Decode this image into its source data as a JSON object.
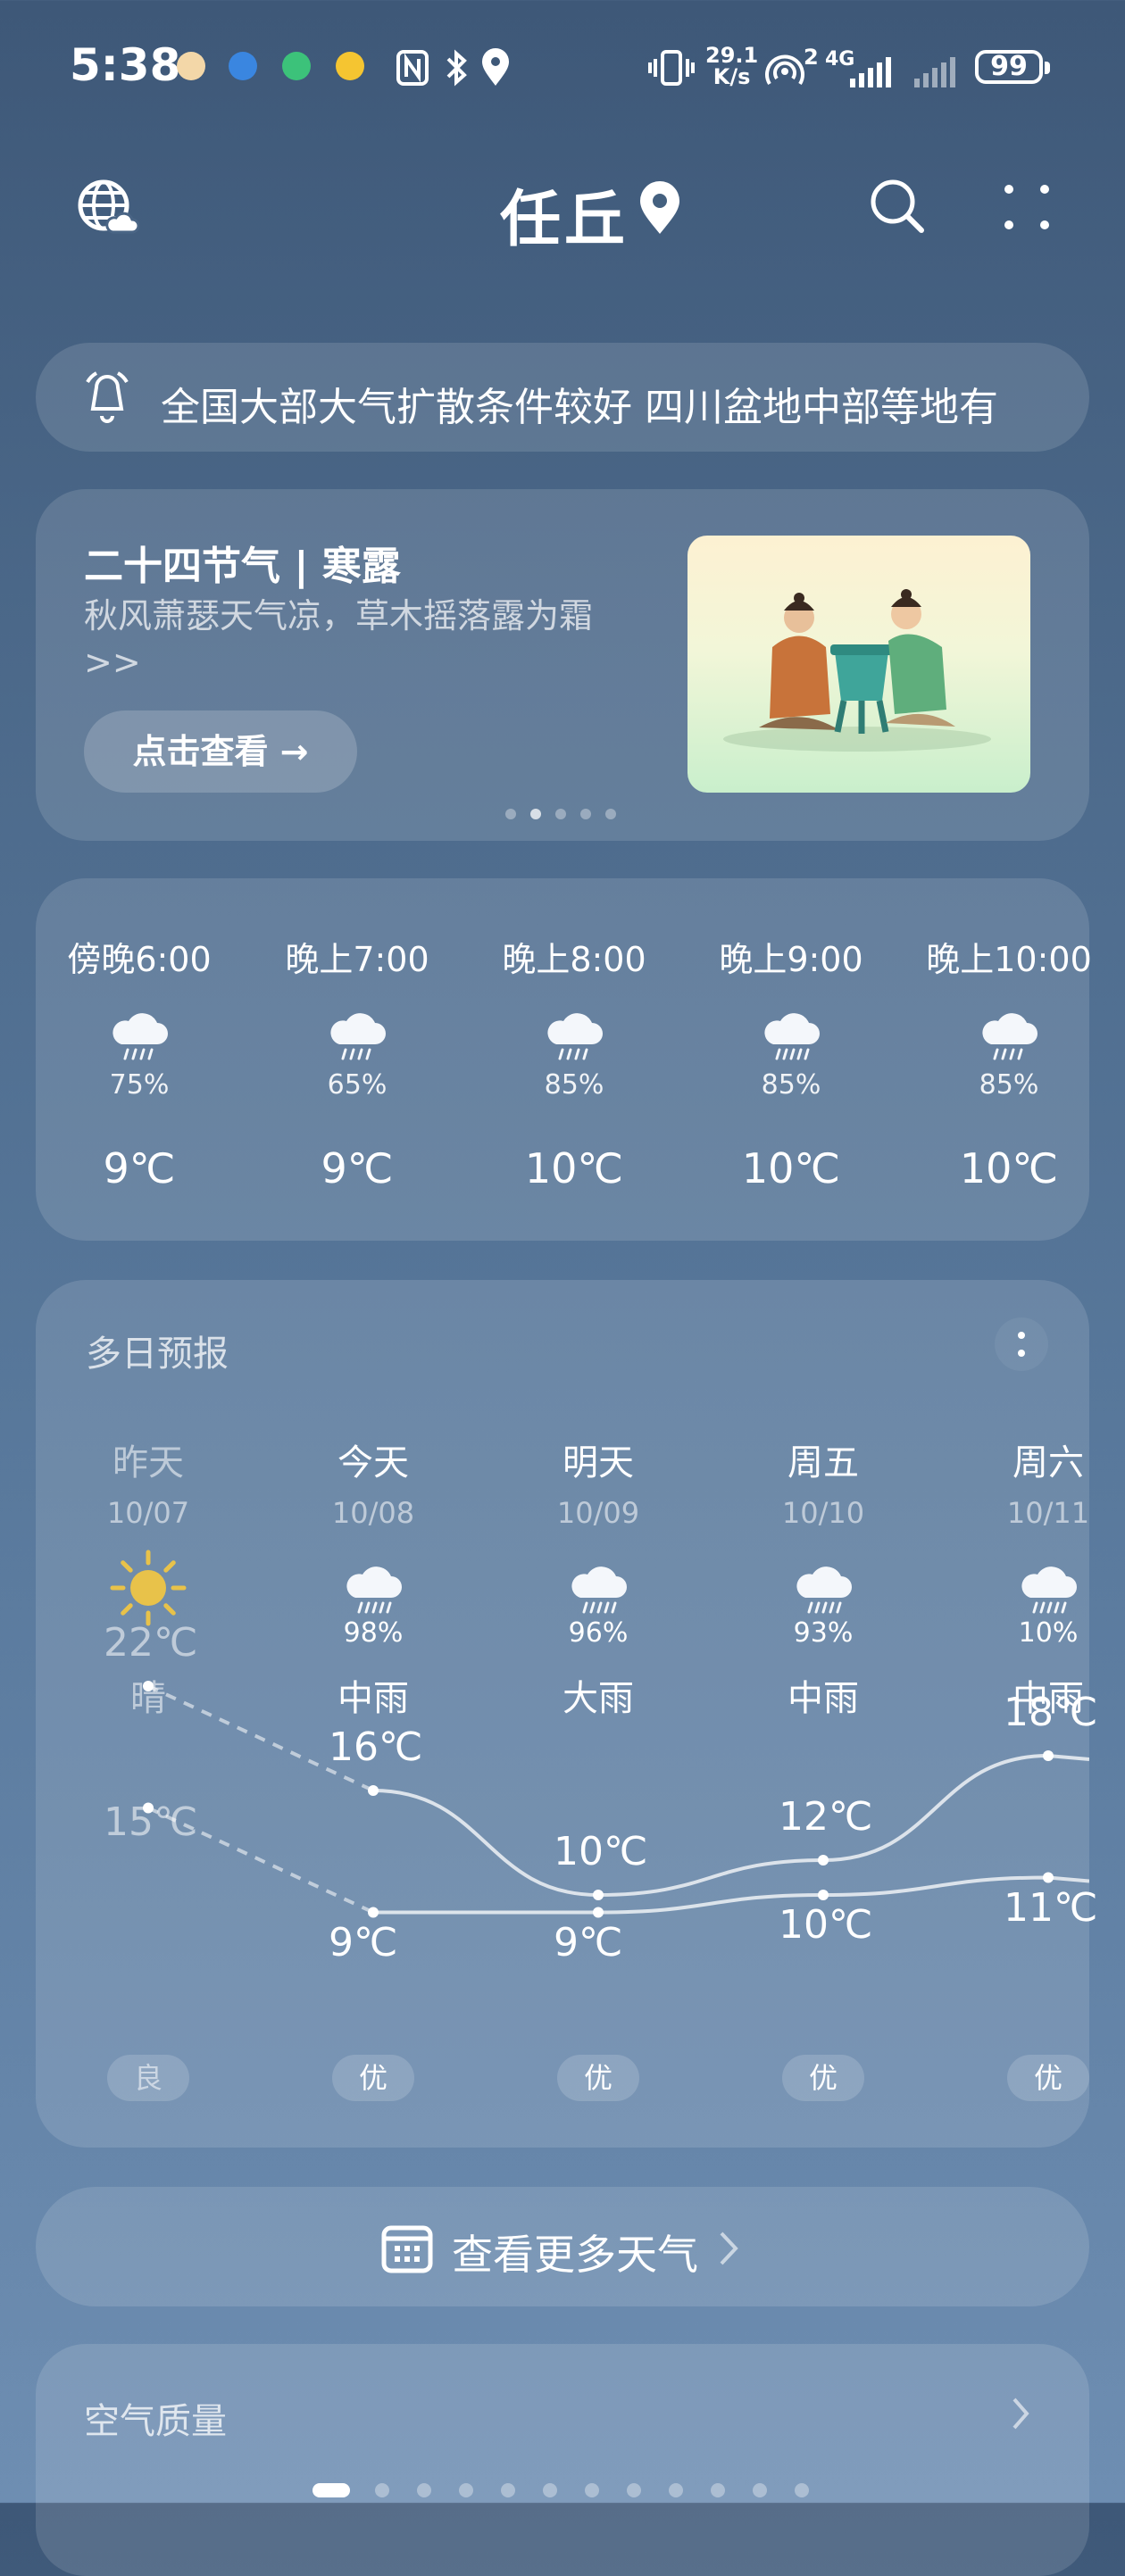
{
  "status_bar": {
    "time": "5:38",
    "net_speed_value": "29.1",
    "net_speed_unit": "K/s",
    "signal_label": "4G",
    "hotspot_count": "2",
    "battery": "99"
  },
  "header": {
    "city": "任丘"
  },
  "news": {
    "text": "全国大部大气扩散条件较好  四川盆地中部等地有"
  },
  "solar_term": {
    "title": "二十四节气 | 寒露",
    "description": "秋风萧瑟天气凉，草木摇落露为霜>>",
    "button_label": "点击查看 →",
    "page_count": 5,
    "active_page": 1
  },
  "hourly": [
    {
      "time": "傍晚6:00",
      "precip": "75%",
      "temp": "9℃",
      "icon": "light-rain-cloud-icon"
    },
    {
      "time": "晚上7:00",
      "precip": "65%",
      "temp": "9℃",
      "icon": "light-rain-cloud-icon"
    },
    {
      "time": "晚上8:00",
      "precip": "85%",
      "temp": "10℃",
      "icon": "light-rain-cloud-icon"
    },
    {
      "time": "晚上9:00",
      "precip": "85%",
      "temp": "10℃",
      "icon": "moderate-rain-cloud-icon"
    },
    {
      "time": "晚上10:00",
      "precip": "85%",
      "temp": "10℃",
      "icon": "light-rain-cloud-icon"
    }
  ],
  "daily": {
    "title": "多日预报",
    "days": [
      {
        "day": "昨天",
        "date": "10/07",
        "precip": "",
        "condition": "晴",
        "high": "22℃",
        "low": "15℃",
        "aqi": "良",
        "icon": "sun-icon"
      },
      {
        "day": "今天",
        "date": "10/08",
        "precip": "98%",
        "condition": "中雨",
        "high": "16℃",
        "low": "9℃",
        "aqi": "优",
        "icon": "rain-cloud-icon"
      },
      {
        "day": "明天",
        "date": "10/09",
        "precip": "96%",
        "condition": "大雨",
        "high": "10℃",
        "low": "9℃",
        "aqi": "优",
        "icon": "rain-cloud-icon"
      },
      {
        "day": "周五",
        "date": "10/10",
        "precip": "93%",
        "condition": "中雨",
        "high": "12℃",
        "low": "10℃",
        "aqi": "优",
        "icon": "rain-cloud-icon"
      },
      {
        "day": "周六",
        "date": "10/11",
        "precip": "10%",
        "condition": "中雨",
        "high": "18℃",
        "low": "11℃",
        "aqi": "优",
        "icon": "rain-cloud-icon"
      }
    ]
  },
  "more_weather": {
    "label": "查看更多天气"
  },
  "air_quality": {
    "title": "空气质量"
  },
  "page_indicator": {
    "count": 12,
    "active": 0
  },
  "colors": {
    "bg_top": "#3e5878",
    "bg_bottom": "#6e8eb2",
    "sun": "#e8c24a"
  }
}
